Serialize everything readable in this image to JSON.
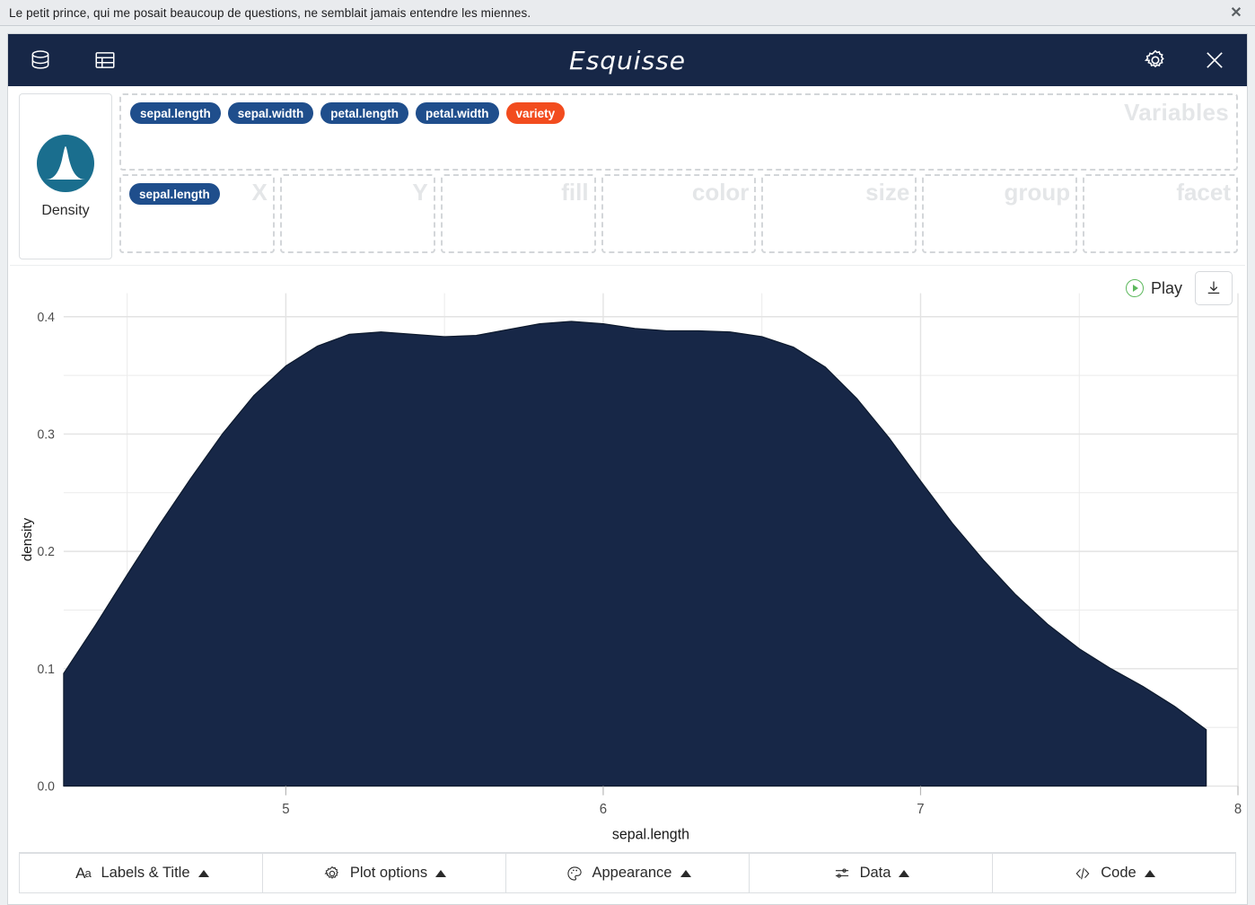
{
  "os_bar": {
    "text": "Le petit prince, qui me posait beaucoup de questions, ne semblait jamais entendre les miennes.",
    "close_label": "✕"
  },
  "header": {
    "title": "Esquisse",
    "icons": [
      {
        "name": "database-icon",
        "label": "Data source"
      },
      {
        "name": "table-icon",
        "label": "Data table"
      },
      {
        "name": "gear-icon",
        "label": "Settings"
      },
      {
        "name": "close-icon",
        "label": "Close"
      }
    ]
  },
  "geom": {
    "label": "Density",
    "icon": "density-curve-icon",
    "color": "#1a6e8e"
  },
  "variables": {
    "ghost_label": "Variables",
    "chips": [
      {
        "label": "sepal.length",
        "kind": "numeric"
      },
      {
        "label": "sepal.width",
        "kind": "numeric"
      },
      {
        "label": "petal.length",
        "kind": "numeric"
      },
      {
        "label": "petal.width",
        "kind": "numeric"
      },
      {
        "label": "variety",
        "kind": "categorical"
      }
    ],
    "colors": {
      "numeric": "#1f4e8c",
      "categorical": "#f24c1e"
    }
  },
  "dropzones": [
    {
      "ghost_label": "X",
      "chips": [
        {
          "label": "sepal.length",
          "kind": "numeric"
        }
      ]
    },
    {
      "ghost_label": "Y",
      "chips": []
    },
    {
      "ghost_label": "fill",
      "chips": []
    },
    {
      "ghost_label": "color",
      "chips": []
    },
    {
      "ghost_label": "size",
      "chips": []
    },
    {
      "ghost_label": "group",
      "chips": []
    },
    {
      "ghost_label": "facet",
      "chips": []
    }
  ],
  "plot_toolbar": {
    "play_label": "Play",
    "play_icon": "play-circle-icon",
    "download_icon": "download-icon"
  },
  "bottom_bar": [
    {
      "label": "Labels & Title",
      "icon": "aa-text-icon"
    },
    {
      "label": "Plot options",
      "icon": "gear-icon"
    },
    {
      "label": "Appearance",
      "icon": "palette-icon"
    },
    {
      "label": "Data",
      "icon": "sliders-icon"
    },
    {
      "label": "Code",
      "icon": "code-icon"
    }
  ],
  "chart_data": {
    "type": "area",
    "title": "",
    "xlabel": "sepal.length",
    "ylabel": "density",
    "xlim": [
      4.3,
      8.0
    ],
    "ylim": [
      0.0,
      0.42
    ],
    "xticks": [
      5,
      6,
      7,
      8
    ],
    "xtick_labels": [
      "5",
      "6",
      "7",
      "8"
    ],
    "yticks": [
      0.0,
      0.1,
      0.2,
      0.3,
      0.4
    ],
    "ytick_labels": [
      "0.0",
      "0.1",
      "0.2",
      "0.3",
      "0.4"
    ],
    "x_minor_ticks": [
      4.5,
      5.5,
      6.5,
      7.5
    ],
    "y_minor_ticks": [
      0.05,
      0.15,
      0.25,
      0.35
    ],
    "grid": true,
    "legend": "none",
    "fill_color": "#172747",
    "panel_background": "#ffffff",
    "grid_color": "#ebebeb",
    "series": [
      {
        "name": "sepal.length density",
        "x": [
          4.3,
          4.4,
          4.5,
          4.6,
          4.7,
          4.8,
          4.9,
          5.0,
          5.1,
          5.2,
          5.3,
          5.4,
          5.5,
          5.6,
          5.7,
          5.8,
          5.9,
          6.0,
          6.1,
          6.2,
          6.3,
          6.4,
          6.5,
          6.6,
          6.7,
          6.8,
          6.9,
          7.0,
          7.1,
          7.2,
          7.3,
          7.4,
          7.5,
          7.6,
          7.7,
          7.8,
          7.9
        ],
        "y": [
          0.096,
          0.137,
          0.18,
          0.222,
          0.262,
          0.3,
          0.333,
          0.358,
          0.375,
          0.385,
          0.387,
          0.385,
          0.383,
          0.384,
          0.389,
          0.394,
          0.396,
          0.394,
          0.39,
          0.388,
          0.388,
          0.387,
          0.383,
          0.374,
          0.357,
          0.33,
          0.297,
          0.26,
          0.224,
          0.192,
          0.163,
          0.138,
          0.117,
          0.1,
          0.085,
          0.068,
          0.048
        ]
      }
    ]
  }
}
